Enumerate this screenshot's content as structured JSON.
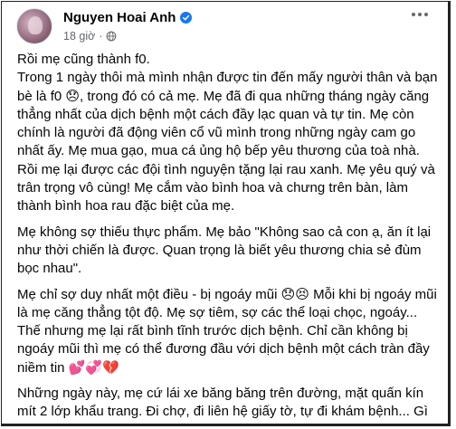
{
  "post": {
    "author": "Nguyen Hoai Anh",
    "time": "18 giờ",
    "separator": "·",
    "paragraphs": [
      "Rồi mẹ cũng thành f0.\nTrong 1 ngày thôi mà mình nhận được tin đến mấy người thân và bạn bè là f0 😞, trong đó có cả mẹ. Mẹ đã đi qua những tháng ngày căng thẳng nhất của dịch bệnh một cách đầy lạc quan và tự tin. Mẹ còn chính là người đã động viên cổ vũ mình trong những ngày cam go nhất ấy. Mẹ mua gạo, mua cá ủng hộ bếp yêu thương của toà nhà. Rồi mẹ lại được các đội tình nguyện tặng lại rau xanh. Mẹ yêu quý và trân trọng vô cùng! Mẹ cắm vào bình hoa và chưng trên bàn, làm thành bình hoa rau đặc biệt của mẹ.",
      "Mẹ không sợ thiếu thực phẩm. Mẹ bảo \"Không sao cả con ạ, ăn ít lại như thời chiến là được. Quan trọng là biết yêu thương chia sẻ đùm bọc nhau\".",
      "Mẹ chỉ sợ duy nhất một điều - bị ngoáy mũi 😞😣 Mỗi khi bị ngoáy mũi là mẹ căng thẳng tột độ. Mẹ sợ tiêm, sợ các thể loại chọc, ngoáy... Thế nhưng mẹ lại rất bình tĩnh trước dịch bệnh. Chỉ cần không bị ngoáy mũi thì mẹ có thể đương đầu với dịch bệnh một cách tràn đầy niềm tin 💕💞💔",
      "Những ngày này, mẹ cứ lái xe băng băng trên đường, mặt quấn kín mít 2 lớp khẩu trang. Đi chợ, đi liên hệ giấy tờ, tự đi khám bệnh... Gì gì mẹ cũng tự đi, tự làm."
    ]
  },
  "icons": {
    "verified": "verified-badge-icon",
    "privacy": "globe-icon",
    "menu": "more-horizontal-icon"
  },
  "colors": {
    "verified": "#1877f2",
    "secondary_text": "#65676b"
  }
}
